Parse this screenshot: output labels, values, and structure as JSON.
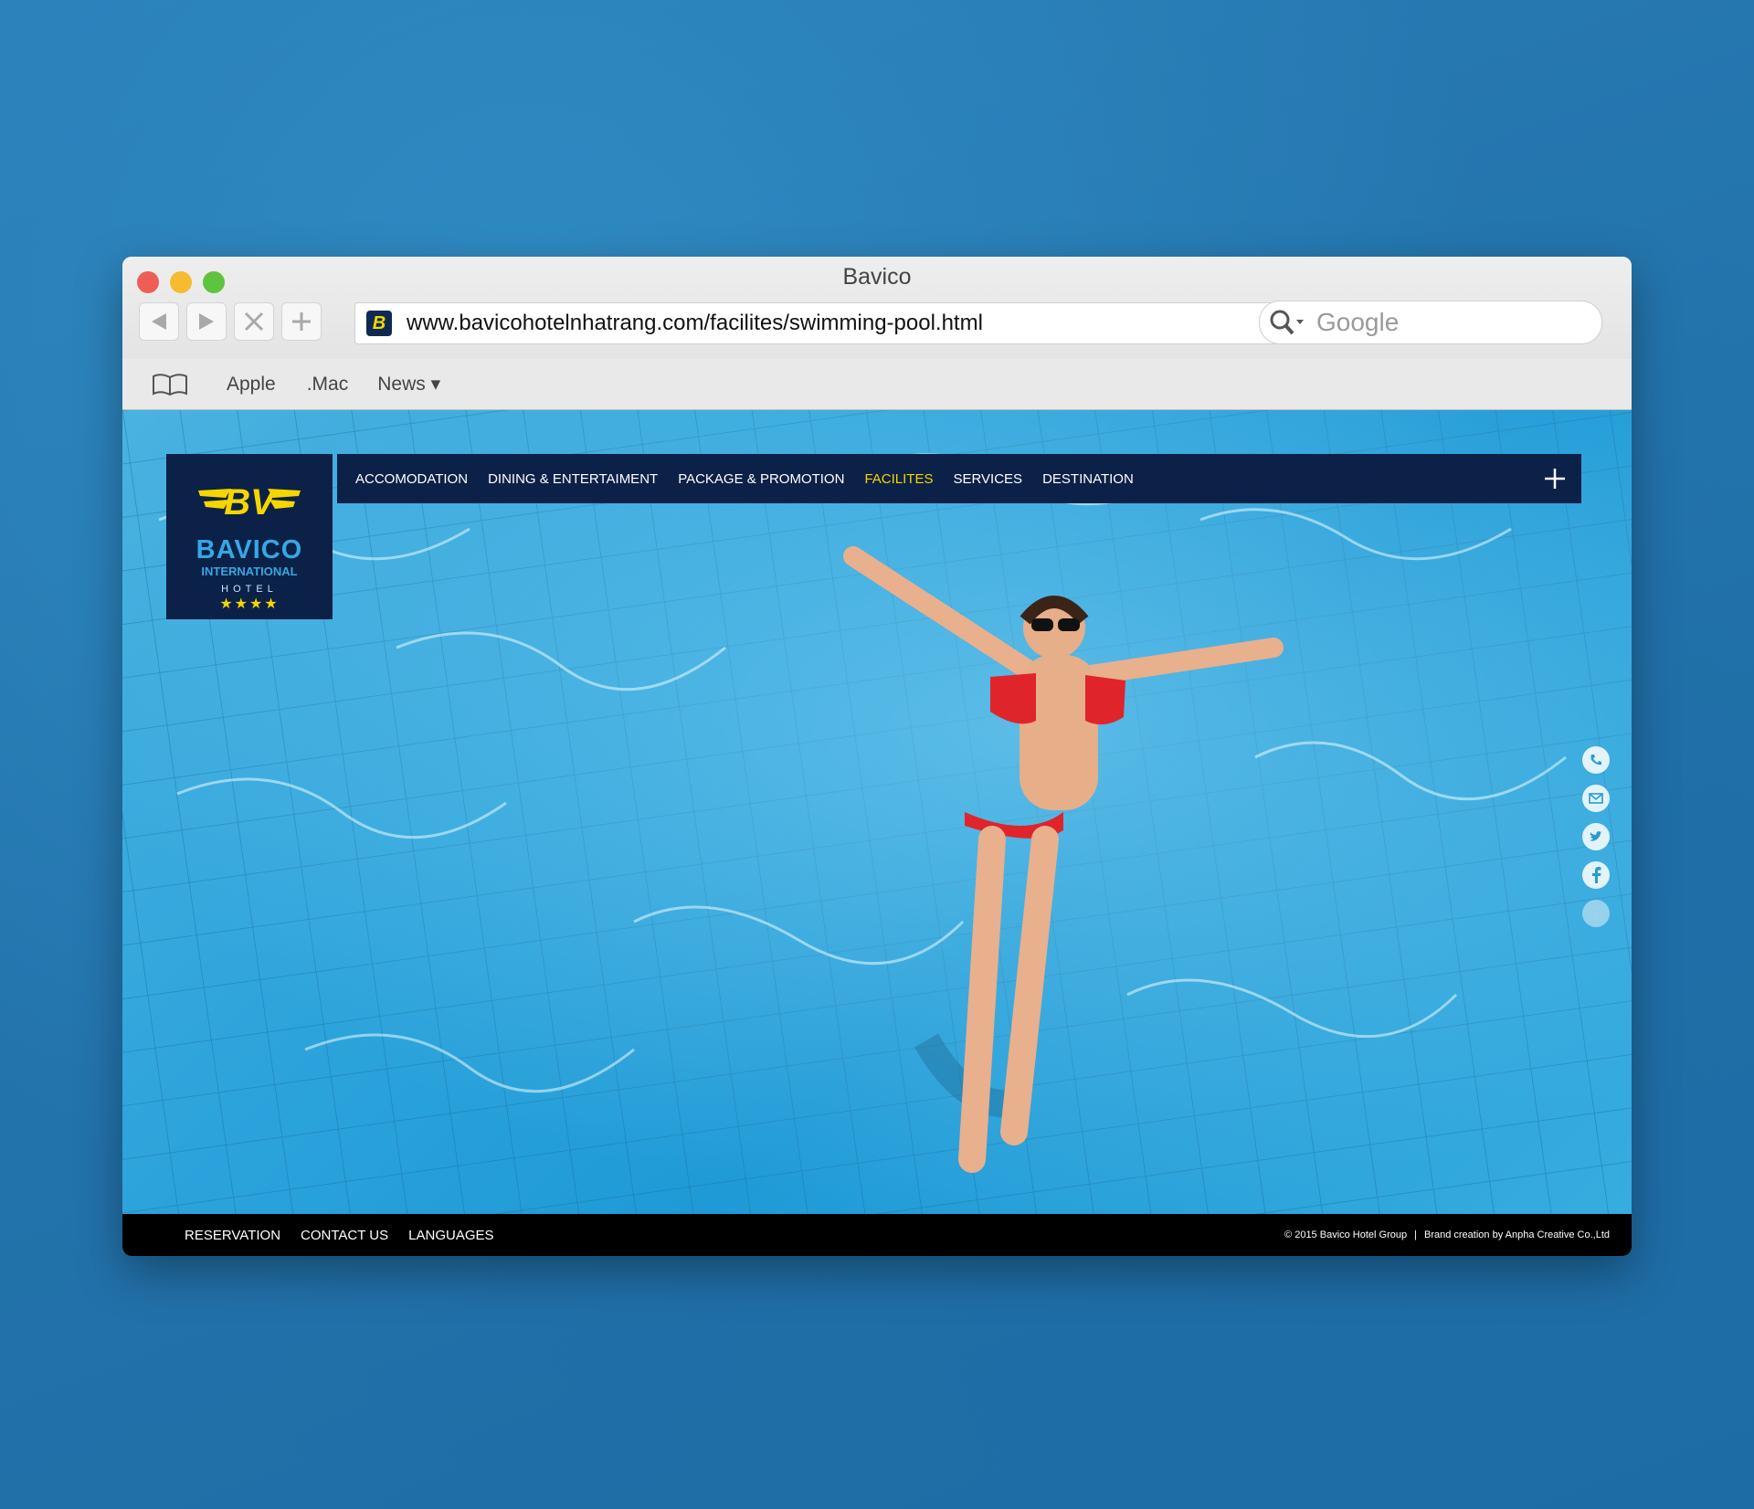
{
  "window": {
    "title": "Bavico"
  },
  "browser": {
    "url": "www.bavicohotelnhatrang.com/facilites/swimming-pool.html",
    "search_placeholder": "Google",
    "favicon_letter": "B",
    "bookmarks": [
      {
        "label": "Apple"
      },
      {
        "label": ".Mac"
      },
      {
        "label": "News ▾"
      }
    ]
  },
  "site": {
    "logo": {
      "brand": "BAVICO",
      "sub": "INTERNATIONAL",
      "hotel": "HOTEL",
      "stars": "★★★★"
    },
    "nav": [
      {
        "label": "ACCOMODATION"
      },
      {
        "label": "DINING & ENTERTAIMENT"
      },
      {
        "label": "PACKAGE & PROMOTION"
      },
      {
        "label": "FACILITES",
        "active": true
      },
      {
        "label": "SERVICES"
      },
      {
        "label": "DESTINATION"
      }
    ],
    "social_icons": [
      "phone-icon",
      "email-icon",
      "twitter-icon",
      "facebook-icon",
      "globe-icon"
    ],
    "footer": {
      "links": [
        {
          "label": "RESERVATION"
        },
        {
          "label": "CONTACT US"
        },
        {
          "label": "LANGUAGES"
        }
      ],
      "copyright": "© 2015 Bavico Hotel Group",
      "credit": "Brand creation by Anpha Creative Co.,Ltd"
    }
  },
  "colors": {
    "navy": "#0c2147",
    "accent_yellow": "#f5d600",
    "logo_blue": "#36a7e4",
    "footer_black": "#000000",
    "pool_blue": "#2ca3db"
  }
}
